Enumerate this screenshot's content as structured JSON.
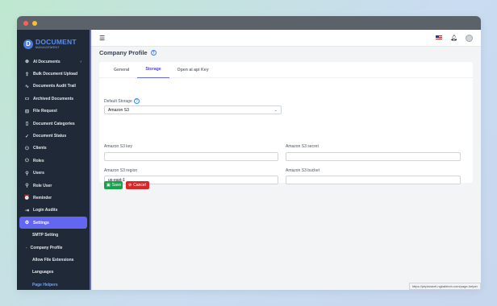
{
  "window": {
    "url_hint": "https://phplaravel.ngkabtech.com/page-helper"
  },
  "logo": {
    "main": "DOCUMENT",
    "sub": "MANAGEMENT",
    "badge": "D"
  },
  "sidebar": {
    "items": [
      {
        "label": "AI Documents",
        "icon": "sparkle-icon",
        "glyph": "⊛",
        "chevron": "›"
      },
      {
        "label": "Bulk Document Upload",
        "icon": "upload-icon",
        "glyph": "⇪"
      },
      {
        "label": "Documents Audit Trail",
        "icon": "activity-icon",
        "glyph": "∿"
      },
      {
        "label": "Archived Documents",
        "icon": "archive-icon",
        "glyph": "▭"
      },
      {
        "label": "File Request",
        "icon": "file-request-icon",
        "glyph": "⊟"
      },
      {
        "label": "Document Categories",
        "icon": "document-icon",
        "glyph": "▯"
      },
      {
        "label": "Document Status",
        "icon": "check-icon",
        "glyph": "✓"
      },
      {
        "label": "Clients",
        "icon": "clients-icon",
        "glyph": "⚇"
      },
      {
        "label": "Roles",
        "icon": "roles-icon",
        "glyph": "⚇"
      },
      {
        "label": "Users",
        "icon": "user-icon",
        "glyph": "⚲"
      },
      {
        "label": "Role User",
        "icon": "role-user-icon",
        "glyph": "⚲"
      },
      {
        "label": "Reminder",
        "icon": "reminder-icon",
        "glyph": "⏰"
      },
      {
        "label": "Login Audits",
        "icon": "login-icon",
        "glyph": "⇥"
      },
      {
        "label": "Settings",
        "icon": "settings-icon",
        "glyph": "⚙"
      }
    ],
    "sub_items": [
      "SMTP Setting",
      "Company Profile",
      "Allow File Extensions",
      "Languages",
      "Page Helpers"
    ]
  },
  "page": {
    "title": "Company Profile"
  },
  "tabs": [
    "General",
    "Storage",
    "Open ai api Key"
  ],
  "form": {
    "default_storage_label": "Default Storage",
    "default_storage_value": "Amazon S3",
    "s3_key_label": "Amazon S3 key",
    "s3_key_value": "",
    "s3_secret_label": "Amazon S3 secret",
    "s3_secret_value": "",
    "s3_region_label": "Amazon S3 region",
    "s3_region_value": "us-east-1",
    "s3_bucket_label": "Amazon S3 bucket",
    "s3_bucket_value": "",
    "save_label": "Save",
    "cancel_label": "Cancel"
  },
  "colors": {
    "accent": "#6366f1",
    "save": "#16a34a",
    "cancel": "#dc2626",
    "sidebar": "#1f2937"
  }
}
